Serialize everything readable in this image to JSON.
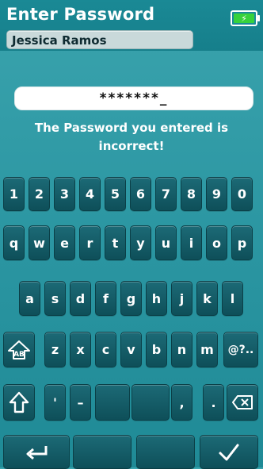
{
  "header": {
    "title": "Enter Password",
    "user": "Jessica Ramos",
    "battery_icon": "battery-charging-icon"
  },
  "password": {
    "value": "*******_",
    "error_line1": "The Password you entered is",
    "error_line2": "incorrect!"
  },
  "keyboard": {
    "row1": [
      "1",
      "2",
      "3",
      "4",
      "5",
      "6",
      "7",
      "8",
      "9",
      "0"
    ],
    "row2": [
      "q",
      "w",
      "e",
      "r",
      "t",
      "y",
      "u",
      "i",
      "o",
      "p"
    ],
    "row3": [
      "a",
      "s",
      "d",
      "f",
      "g",
      "h",
      "j",
      "k",
      "l"
    ],
    "row4_letters": [
      "z",
      "x",
      "c",
      "v",
      "b",
      "n",
      "m"
    ],
    "symbols_key": "@?..",
    "row5_apostrophe": "'",
    "row5_dash": "–",
    "row5_comma": ",",
    "row5_period": ".",
    "icons": {
      "case_toggle": "case-toggle-icon",
      "shift": "shift-icon",
      "backspace": "backspace-icon",
      "return": "return-icon",
      "confirm": "checkmark-icon"
    }
  },
  "colors": {
    "background": "#2a95a1",
    "key": "#0e4f59",
    "battery_fill": "#36d23c"
  }
}
